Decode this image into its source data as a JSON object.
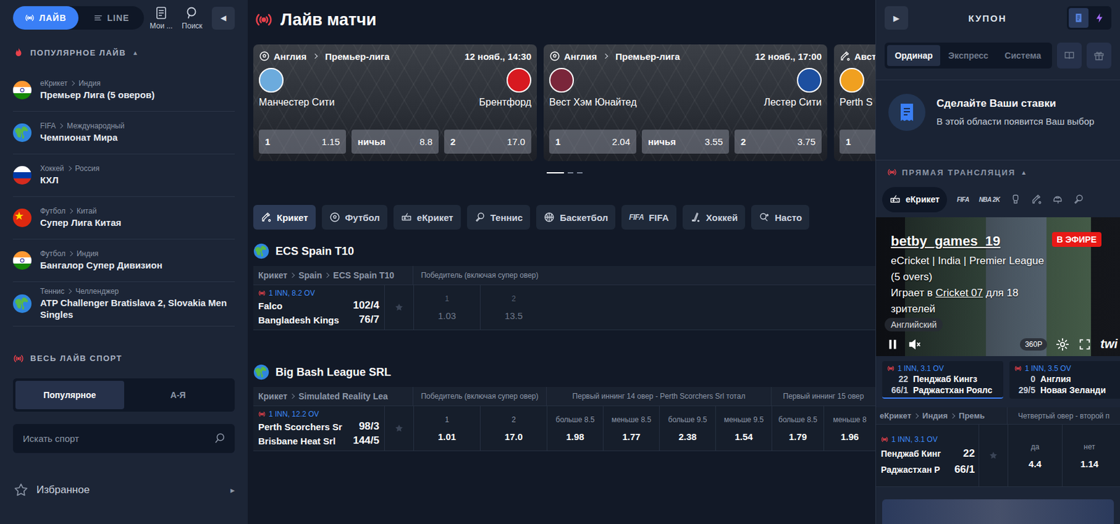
{
  "sidebar": {
    "mode_tabs": [
      {
        "label": "ЛАЙВ",
        "kind": "live",
        "selected": true
      },
      {
        "label": "LINE",
        "kind": "line",
        "selected": false
      }
    ],
    "tools": [
      {
        "label": "Мои ...",
        "kind": "bets"
      },
      {
        "label": "Поиск",
        "kind": "search"
      }
    ],
    "collapse_button": "◀",
    "popular": {
      "title": "ПОПУЛЯРНОЕ ЛАЙВ",
      "toggle": "▲",
      "expanded": true,
      "items": [
        {
          "kind": "india",
          "sport": "еКрикет",
          "country": "Индия",
          "name": "Премьер Лига (5 оверов)"
        },
        {
          "kind": "world",
          "sport": "FIFA",
          "country": "Международный",
          "name": "Чемпионат Мира"
        },
        {
          "kind": "russia",
          "sport": "Хоккей",
          "country": "Россия",
          "name": "КХЛ"
        },
        {
          "kind": "china",
          "sport": "Футбол",
          "country": "Китай",
          "name": "Супер Лига Китая"
        },
        {
          "kind": "india",
          "sport": "Футбол",
          "country": "Индия",
          "name": "Бангалор Супер Дивизион"
        },
        {
          "kind": "world",
          "sport": "Теннис",
          "country": "Челленджер",
          "name": "ATP Challenger Bratislava 2, Slovakia Men Singles"
        }
      ]
    },
    "all_sport": {
      "title": "ВЕСЬ ЛАЙВ СПОРТ",
      "tabs": [
        {
          "label": "Популярное",
          "selected": true
        },
        {
          "label": "А-Я",
          "selected": false
        }
      ],
      "search": {
        "placeholder": "Искать спорт"
      }
    },
    "favorites": {
      "label": "Избранное",
      "arrow": "▸"
    }
  },
  "main": {
    "title": "Лайв матчи",
    "featured": [
      {
        "sport": "football",
        "country": "Англия",
        "league": "Премьер-лига",
        "time": "12 нояб., 14:30",
        "home": {
          "name": "Манчестер Сити",
          "color": "#6cabdd"
        },
        "away": {
          "name": "Брентфорд",
          "color": "#d71920"
        },
        "odds": [
          {
            "label": "1",
            "value": "1.15"
          },
          {
            "label": "ничья",
            "value": "8.8"
          },
          {
            "label": "2",
            "value": "17.0"
          }
        ]
      },
      {
        "sport": "football",
        "country": "Англия",
        "league": "Премьер-лига",
        "time": "12 нояб., 17:00",
        "home": {
          "name": "Вест Хэм Юнайтед",
          "color": "#7a263a"
        },
        "away": {
          "name": "Лестер Сити",
          "color": "#1d4fa0"
        },
        "odds": [
          {
            "label": "1",
            "value": "2.04"
          },
          {
            "label": "ничья",
            "value": "3.55"
          },
          {
            "label": "2",
            "value": "3.75"
          }
        ]
      },
      {
        "sport": "cricket",
        "country": "Авст",
        "home": {
          "name": "Perth S",
          "color": "#f0a020"
        },
        "odds": [
          {
            "label": "1"
          }
        ]
      }
    ],
    "pager": [
      {
        "selected": true
      },
      {
        "selected": false
      },
      {
        "selected": false
      }
    ],
    "sport_tabs": [
      {
        "label": "Крикет",
        "kind": "cricket",
        "selected": true
      },
      {
        "label": "Футбол",
        "kind": "football",
        "selected": false
      },
      {
        "label": "еКрикет",
        "kind": "ecricket",
        "selected": false
      },
      {
        "label": "Теннис",
        "kind": "tennis",
        "selected": false
      },
      {
        "label": "Баскетбол",
        "kind": "basketball",
        "selected": false
      },
      {
        "label": "FIFA",
        "kind": "text",
        "icon_text": "FIFA",
        "selected": false
      },
      {
        "label": "Хоккей",
        "kind": "hockey",
        "selected": false
      },
      {
        "label": "Насто",
        "kind": "table",
        "selected": false
      }
    ],
    "sections": [
      {
        "title": "ECS Spain T10",
        "breadcrumb": [
          "Крикет",
          "Spain",
          "ECS Spain T10"
        ],
        "markets": [
          {
            "title": "Победитель (включая супер овер)",
            "columns": [
              "1",
              "2"
            ]
          }
        ],
        "events": [
          {
            "status": "1 INN, 8.2 OV",
            "teams": [
              {
                "name": "Falco",
                "score": "102/4"
              },
              {
                "name": "Bangladesh Kings",
                "score": "76/7"
              }
            ],
            "favorite": false,
            "suspended": true,
            "odds": [
              "1.03",
              "13.5"
            ]
          }
        ]
      },
      {
        "title": "Big Bash League SRL",
        "breadcrumb": [
          "Крикет",
          "Simulated Reality Lea"
        ],
        "markets": [
          {
            "title": "Победитель (включая супер овер)",
            "columns": [
              "1",
              "2"
            ]
          },
          {
            "title": "Первый иннинг 14 овер - Perth Scorchers Srl тотал",
            "columns": [
              "больше 8.5",
              "меньше 8.5",
              "больше 9.5",
              "меньше 9.5"
            ]
          },
          {
            "title": "Первый иннинг 15 овер",
            "columns": [
              "больше 8.5",
              "меньше 8"
            ]
          }
        ],
        "events": [
          {
            "status": "1 INN, 12.2 OV",
            "teams": [
              {
                "name": "Perth Scorchers Sr",
                "score": "98/3"
              },
              {
                "name": "Brisbane Heat Srl",
                "score": "144/5"
              }
            ],
            "favorite": false,
            "suspended": false,
            "odds": [
              "1.01",
              "17.0",
              "1.98",
              "1.77",
              "2.38",
              "1.54",
              "1.79",
              "1.96"
            ]
          }
        ]
      }
    ]
  },
  "coupon": {
    "play_button": "▶",
    "title": "КУПОН",
    "modes": [
      {
        "kind": "doc",
        "selected": true
      },
      {
        "kind": "bolt",
        "selected": false
      }
    ],
    "tabs": [
      {
        "label": "Ординар",
        "selected": true
      },
      {
        "label": "Экспресс",
        "selected": false
      },
      {
        "label": "Система",
        "selected": false
      }
    ],
    "tools": [
      {
        "kind": "book"
      },
      {
        "kind": "gift"
      }
    ],
    "empty": {
      "title": "Сделайте Ваши ставки",
      "text": "В этой области появится Ваш выбор"
    }
  },
  "stream": {
    "title": "ПРЯМАЯ ТРАНСЛЯЦИЯ",
    "toggle": "▲",
    "expanded": true,
    "sports": [
      {
        "label": "еКрикет",
        "kind": "ecricket",
        "selected": true
      },
      {
        "kind": "text",
        "icon_text": "FIFA",
        "selected": false
      },
      {
        "kind": "text",
        "icon_text": "NBA 2K",
        "selected": false
      },
      {
        "kind": "glove",
        "selected": false
      },
      {
        "kind": "cricket",
        "selected": false
      },
      {
        "kind": "helmet",
        "selected": false
      },
      {
        "kind": "tennis",
        "selected": false
      }
    ],
    "player": {
      "channel": "betby_games_19",
      "live_badge": "В ЭФИРЕ",
      "description": "eCricket | India | Premier League (5 overs)",
      "playing_line": {
        "prefix": "Играет в",
        "game": "Cricket 07",
        "suffix": "для 18 зрителей"
      },
      "language": "Английский",
      "quality": "360P",
      "logo": "twi",
      "playing": true,
      "muted": true
    },
    "matches": [
      {
        "status": "1 INN, 3.1 OV",
        "teams": [
          {
            "score": "22",
            "name": "Пенджаб Кингз"
          },
          {
            "score": "66/1",
            "name": "Раджастхан Роялс"
          }
        ],
        "selected": true
      },
      {
        "status": "1 INN, 3.5 OV",
        "teams": [
          {
            "score": "0",
            "name": "Англия"
          },
          {
            "score": "29/5",
            "name": "Новая Зеланди"
          }
        ],
        "selected": false
      }
    ],
    "market": {
      "breadcrumb": [
        "еКрикет",
        "Индия",
        "Премь"
      ],
      "title": "Четвертый овер - второй п",
      "columns": [
        "да",
        "нет"
      ],
      "event": {
        "status": "1 INN, 3.1 OV",
        "teams": [
          {
            "name": "Пенджаб Кинг",
            "score": "22"
          },
          {
            "name": "Раджастхан Р",
            "score": "66/1"
          }
        ],
        "favorite": false,
        "odds": [
          "4.4",
          "1.14"
        ]
      }
    }
  }
}
